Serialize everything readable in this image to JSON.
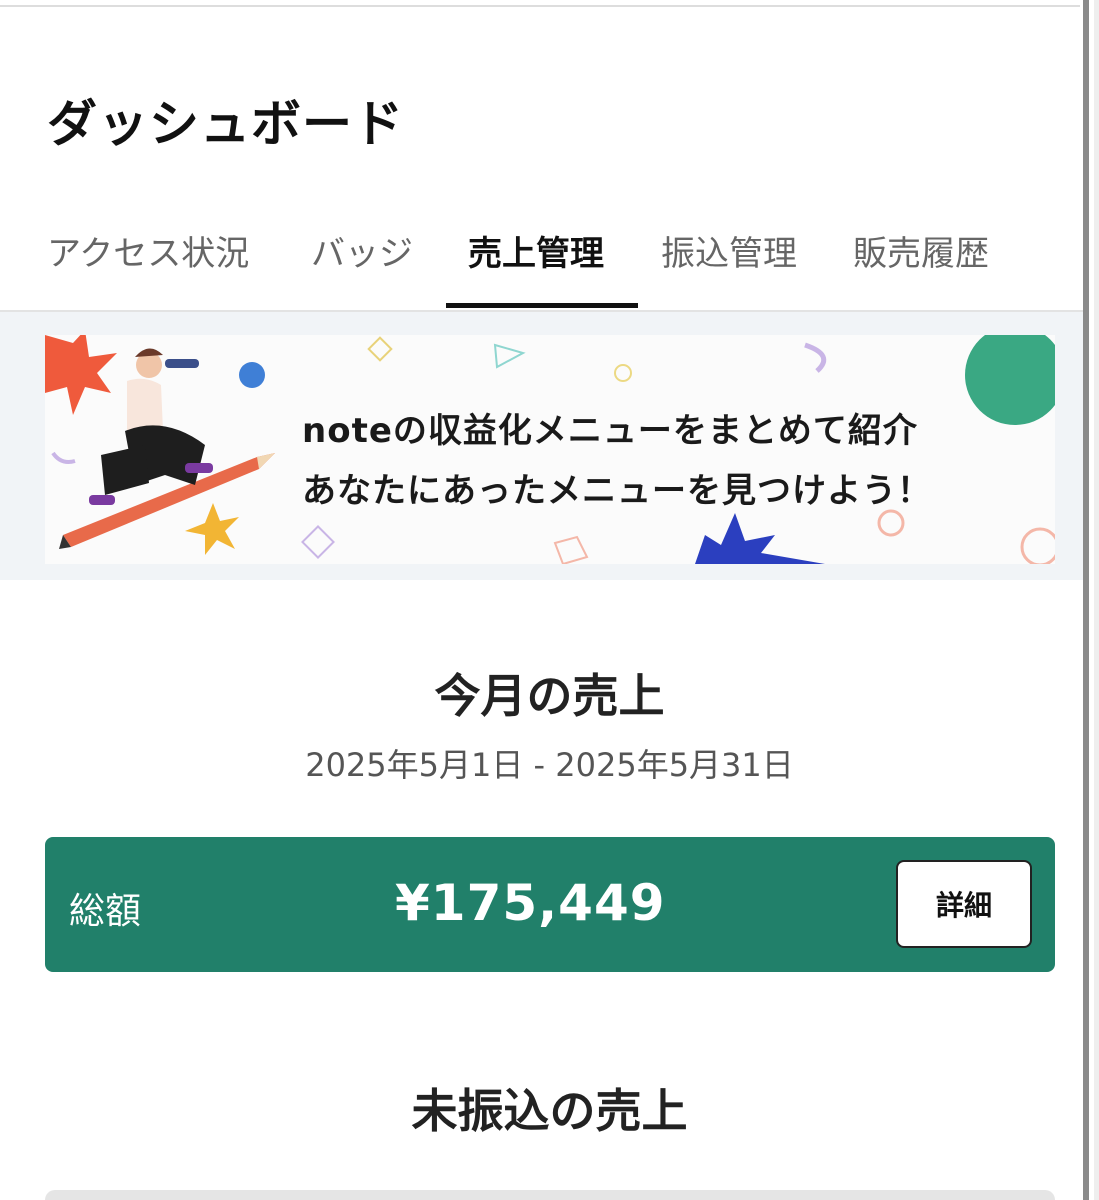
{
  "header": {
    "title": "ダッシュボード"
  },
  "tabs": [
    {
      "label": "アクセス状況",
      "active": false
    },
    {
      "label": "バッジ",
      "active": false
    },
    {
      "label": "売上管理",
      "active": true
    },
    {
      "label": "振込管理",
      "active": false
    },
    {
      "label": "販売履歴",
      "active": false
    }
  ],
  "banner": {
    "line1": "noteの収益化メニューをまとめて紹介",
    "line2": "あなたにあったメニューを見つけよう！"
  },
  "monthly_sales": {
    "title": "今月の売上",
    "date_range": "2025年5月1日 - 2025年5月31日",
    "total_label": "総額",
    "total_amount": "¥175,449",
    "detail_button_label": "詳細"
  },
  "unpaid_sales": {
    "title": "未振込の売上"
  },
  "colors": {
    "accent_green": "#21806a",
    "text_primary": "#111111",
    "text_secondary": "#666666",
    "banner_background": "#f1f4f7"
  }
}
